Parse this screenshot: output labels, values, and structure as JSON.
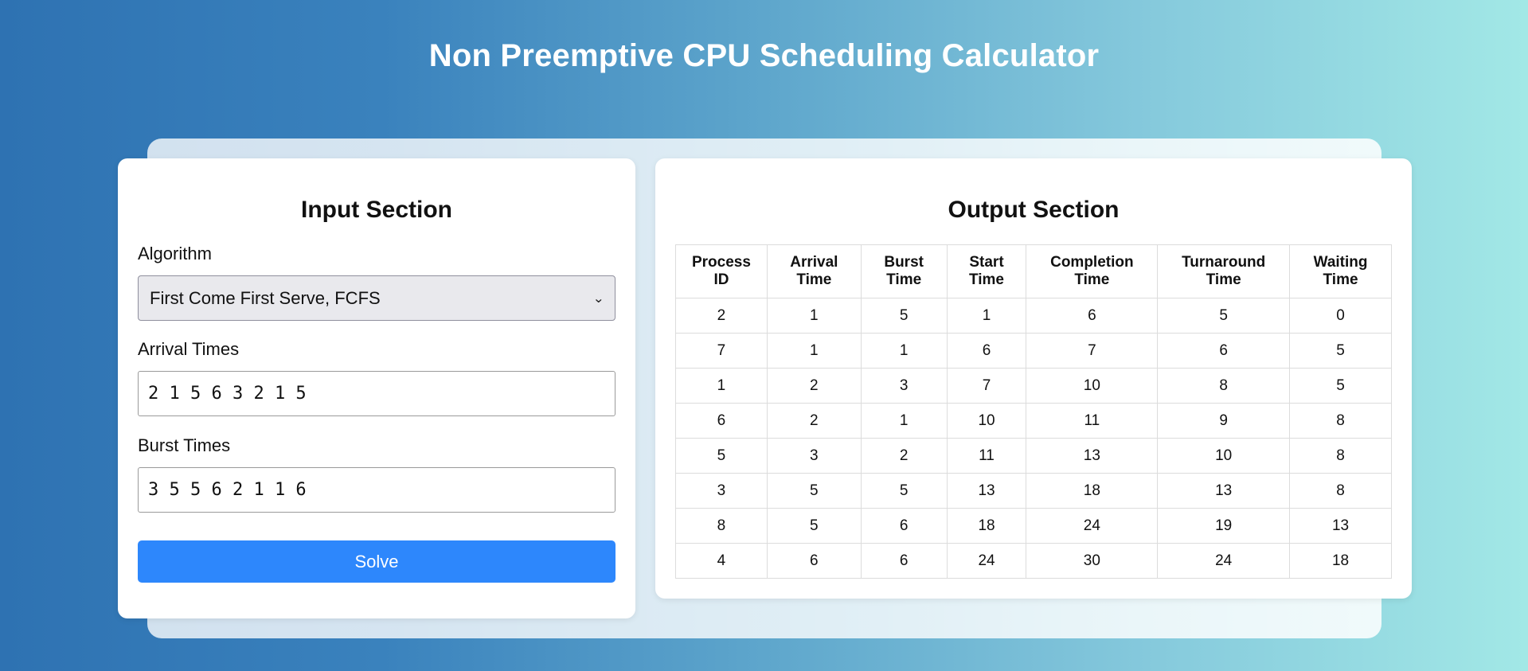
{
  "header": {
    "title": "Non Preemptive CPU Scheduling Calculator"
  },
  "input": {
    "title": "Input Section",
    "algorithm_label": "Algorithm",
    "algorithm_value": "First Come First Serve, FCFS",
    "arrival_label": "Arrival Times",
    "arrival_value": "2 1 5 6 3 2 1 5",
    "burst_label": "Burst Times",
    "burst_value": "3 5 5 6 2 1 1 6",
    "solve_label": "Solve"
  },
  "output": {
    "title": "Output Section",
    "columns": [
      [
        "Process",
        "ID"
      ],
      [
        "Arrival",
        "Time"
      ],
      [
        "Burst",
        "Time"
      ],
      [
        "Start",
        "Time"
      ],
      [
        "Completion",
        "Time"
      ],
      [
        "Turnaround",
        "Time"
      ],
      [
        "Waiting",
        "Time"
      ]
    ],
    "rows": [
      [
        "2",
        "1",
        "5",
        "1",
        "6",
        "5",
        "0"
      ],
      [
        "7",
        "1",
        "1",
        "6",
        "7",
        "6",
        "5"
      ],
      [
        "1",
        "2",
        "3",
        "7",
        "10",
        "8",
        "5"
      ],
      [
        "6",
        "2",
        "1",
        "10",
        "11",
        "9",
        "8"
      ],
      [
        "5",
        "3",
        "2",
        "11",
        "13",
        "10",
        "8"
      ],
      [
        "3",
        "5",
        "5",
        "13",
        "18",
        "13",
        "8"
      ],
      [
        "8",
        "5",
        "6",
        "18",
        "24",
        "19",
        "13"
      ],
      [
        "4",
        "6",
        "6",
        "24",
        "30",
        "24",
        "18"
      ]
    ]
  },
  "colors": {
    "accent": "#2d87fc",
    "gradient_start": "#2e72b2",
    "gradient_end": "#a2e8e6"
  },
  "icons": {
    "select_arrow": "chevron-down-icon"
  }
}
